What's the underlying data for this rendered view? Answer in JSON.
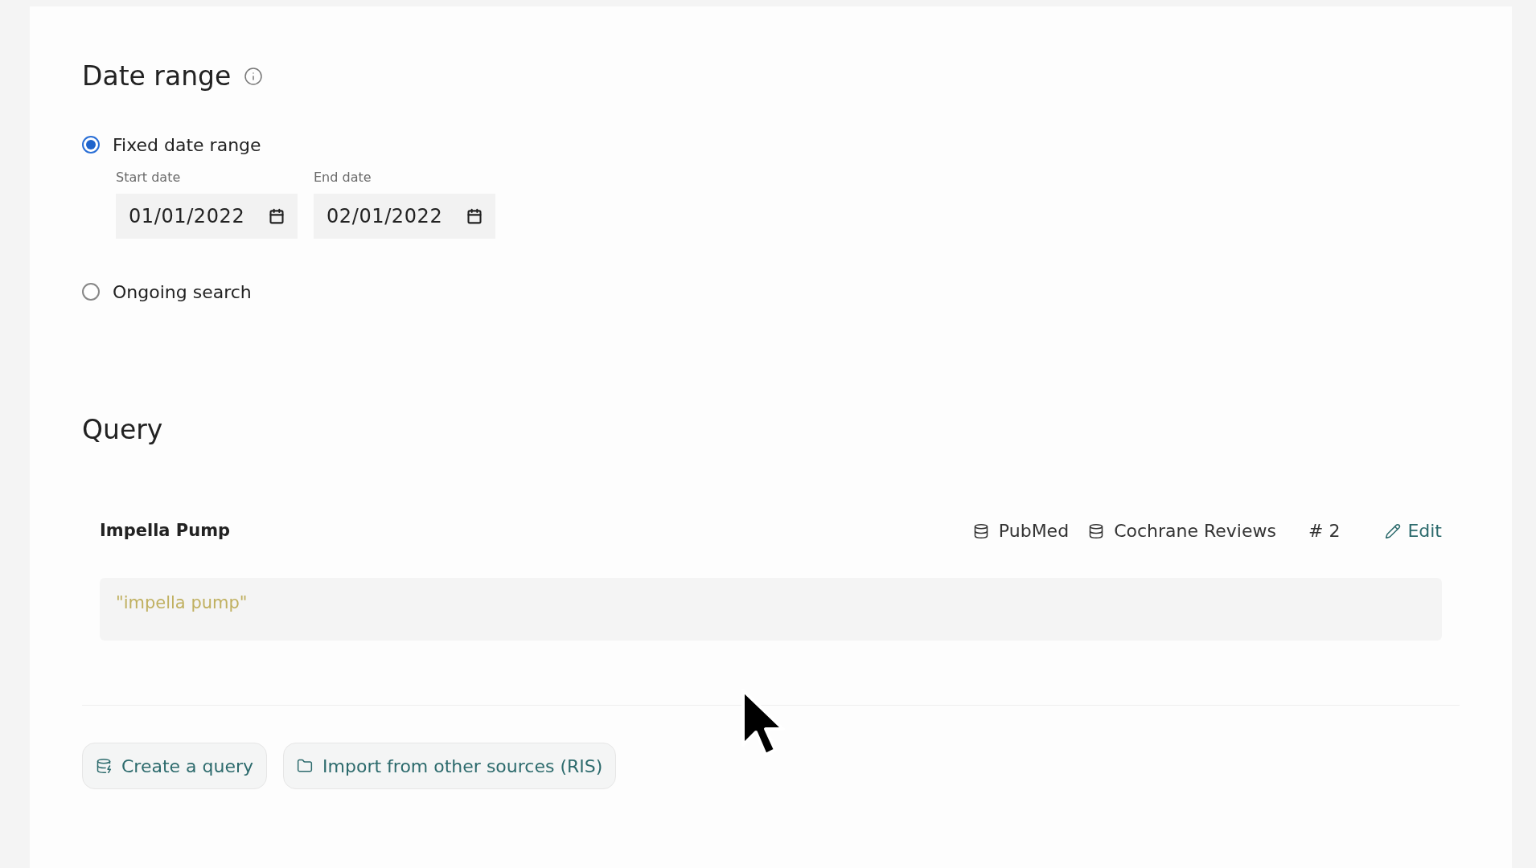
{
  "date_range": {
    "title": "Date range",
    "options": [
      {
        "label": "Fixed date range",
        "selected": true,
        "kind": "fixed"
      },
      {
        "label": "Ongoing search",
        "selected": false,
        "kind": "ongoing"
      }
    ],
    "fields": [
      {
        "label": "Start date",
        "value": "01/01/2022"
      },
      {
        "label": "End date",
        "value": "02/01/2022"
      }
    ]
  },
  "query": {
    "title": "Query",
    "item": {
      "name": "Impella Pump",
      "sources": [
        "PubMed",
        "Cochrane Reviews"
      ],
      "count_symbol": "#",
      "count": "2",
      "edit": "Edit",
      "text": "\"impella pump\""
    },
    "buttons": [
      {
        "label": "Create a query",
        "kind": "create"
      },
      {
        "label": "Import from other sources (RIS)",
        "kind": "import"
      }
    ]
  }
}
